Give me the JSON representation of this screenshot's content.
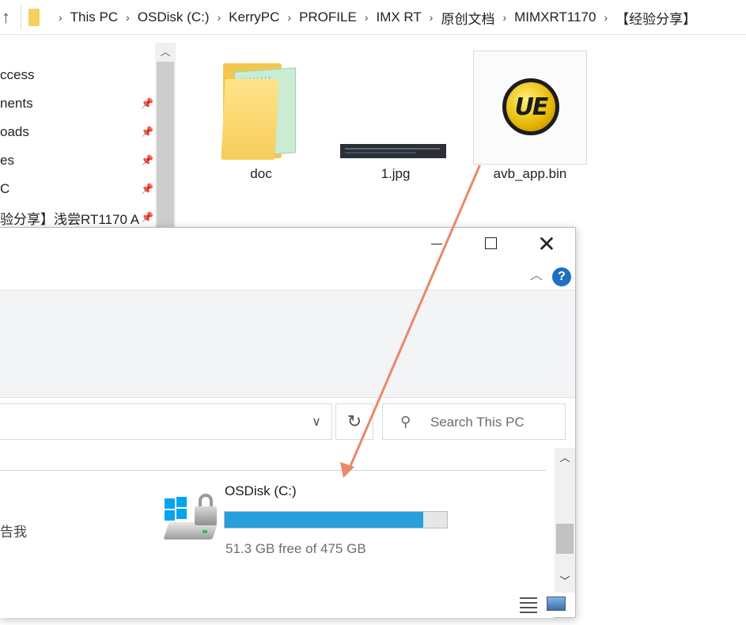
{
  "background_window": {
    "breadcrumbs": [
      "This PC",
      "OSDisk (C:)",
      "KerryPC",
      "PROFILE",
      "IMX RT",
      "原创文档",
      "MIMXRT1170",
      "【经验分享】"
    ],
    "nav_items": [
      "ccess",
      "nents",
      "oads",
      "es",
      "C",
      "验分享】浅尝RT1170 A"
    ],
    "files": [
      {
        "name": "doc",
        "icon": "folder-icon"
      },
      {
        "name": "1.jpg",
        "icon": "image-thumbnail"
      },
      {
        "name": "avb_app.bin",
        "icon": "ultraedit-icon"
      }
    ],
    "ue_logo_text": "UE"
  },
  "dialog": {
    "help_label": "?",
    "search_placeholder": "Search This PC",
    "left_cut_text": "告我",
    "drive": {
      "name": "OSDisk (C:)",
      "free_text": "51.3 GB free of 475 GB",
      "used_fraction": 0.892
    }
  },
  "colors": {
    "drive_bar_fill": "#26a0da",
    "arrow": "#e8896a",
    "help_button": "#1f6fc4"
  }
}
